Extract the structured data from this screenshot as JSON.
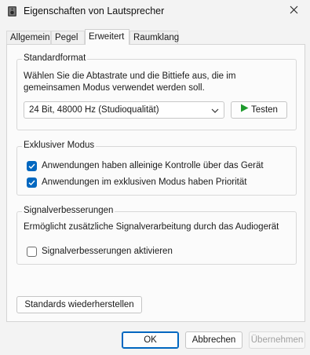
{
  "window": {
    "title": "Eigenschaften von Lautsprecher",
    "icon": "speaker-icon",
    "close_icon": "close-icon"
  },
  "tabs": [
    {
      "label": "Allgemein",
      "active": false
    },
    {
      "label": "Pegel",
      "active": false
    },
    {
      "label": "Erweitert",
      "active": true
    },
    {
      "label": "Raumklang",
      "active": false
    }
  ],
  "standardformat": {
    "legend": "Standardformat",
    "description_line1": "Wählen Sie die Abtastrate und die Bittiefe aus, die im",
    "description_line2": "gemeinsamen Modus verwendet werden soll.",
    "selected_format": "24 Bit, 48000 Hz (Studioqualität)",
    "test_button_label": "Testen",
    "play_icon_color": "#1e9a2c"
  },
  "exklusiv": {
    "legend": "Exklusiver Modus",
    "options": [
      {
        "label": "Anwendungen haben alleinige Kontrolle über das Gerät",
        "checked": true
      },
      {
        "label": "Anwendungen im exklusiven Modus haben Priorität",
        "checked": true
      }
    ]
  },
  "signal": {
    "legend": "Signalverbesserungen",
    "description": "Ermöglicht zusätzliche Signalverarbeitung durch das Audiogerät",
    "option_label": "Signalverbesserungen aktivieren",
    "option_checked": false
  },
  "restore_button_label": "Standards wiederherstellen",
  "footer": {
    "ok_label": "OK",
    "cancel_label": "Abbrechen",
    "apply_label": "Übernehmen"
  },
  "colors": {
    "accent": "#0067c0"
  }
}
